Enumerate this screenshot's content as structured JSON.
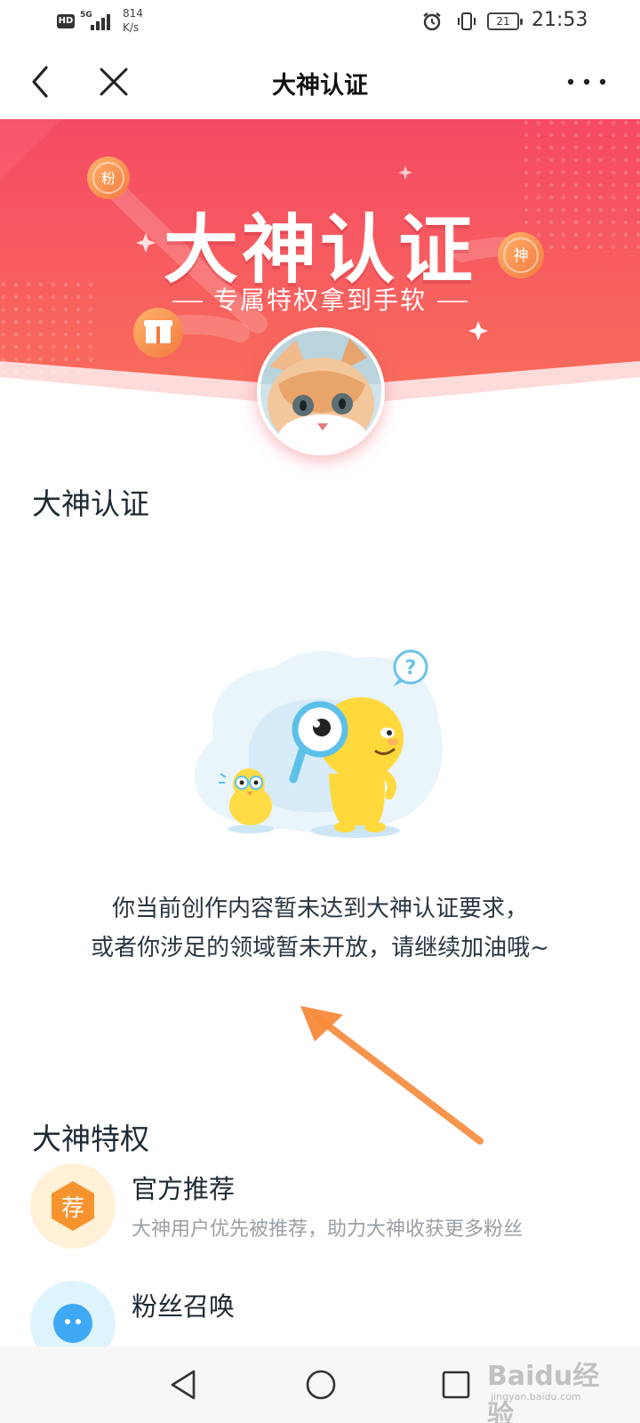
{
  "status_bar": {
    "hd": "HD",
    "network": "5G",
    "speed_value": "814",
    "speed_unit": "K/s",
    "battery": "21",
    "time": "21:53"
  },
  "nav": {
    "title": "大神认证"
  },
  "banner": {
    "title": "大神认证",
    "subtitle": "专属特权拿到手软",
    "coin_left_top": "粉",
    "coin_right": "神",
    "colors": {
      "top": "#f54a64",
      "bottom": "#f86c5c"
    }
  },
  "certification": {
    "title": "大神认证",
    "message_line1": "你当前创作内容暂未达到大神认证要求，",
    "message_line2": "或者你涉足的领域暂未开放，请继续加油哦~"
  },
  "privileges": {
    "title": "大神特权",
    "items": [
      {
        "icon_char": "荐",
        "icon": "recommend-icon",
        "title": "官方推荐",
        "desc": "大神用户优先被推荐，助力大神收获更多粉丝"
      },
      {
        "icon_char": "",
        "icon": "fan-call-icon",
        "title": "粉丝召唤",
        "desc": ""
      }
    ]
  },
  "watermark": {
    "logo": "Baidu经验",
    "url": "jingyan.baidu.com"
  },
  "colors": {
    "annotation_arrow": "#f7893a",
    "accent": "#f54a64"
  }
}
